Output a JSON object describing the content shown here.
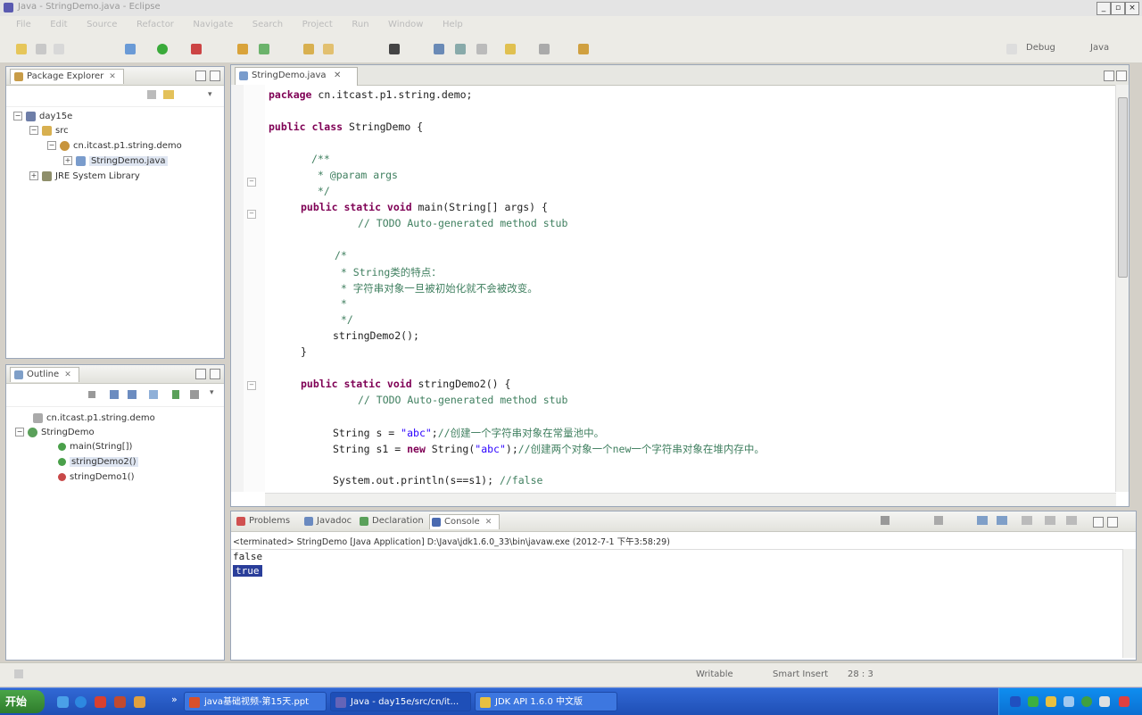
{
  "colors": {
    "keyword": "#7f0055",
    "string": "#2a00ff",
    "comment": "#3f7f5f",
    "taskbar": "#245edb",
    "start_button": "#3c8d39"
  },
  "menu": [
    "File",
    "Edit",
    "Source",
    "Refactor",
    "Navigate",
    "Search",
    "Project",
    "Run",
    "Window",
    "Help"
  ],
  "perspectives": {
    "debug": "Debug",
    "java": "Java"
  },
  "package_explorer": {
    "title": "Package Explorer",
    "project": "day15e",
    "src": "src",
    "package": "cn.itcast.p1.string.demo",
    "file": "StringDemo.java",
    "library": "JRE System Library"
  },
  "outline": {
    "title": "Outline",
    "package": "cn.itcast.p1.string.demo",
    "class": "StringDemo",
    "members": [
      "main(String[])",
      "stringDemo2()",
      "stringDemo1()"
    ]
  },
  "editor": {
    "tab_label": "StringDemo.java",
    "code": {
      "l1_kw": "package",
      "l1_rest": " cn.itcast.p1.string.demo;",
      "l2_kw": "public class",
      "l2_rest": " StringDemo {",
      "l3": "/**",
      "l4": " * @param args",
      "l5": " */",
      "l6_kw": "public static void",
      "l6_rest": " main(String[] args) {",
      "l7": "// TODO Auto-generated method stub",
      "l8": "/*",
      "l9": " * String类的特点：",
      "l10": " * 字符串对象一旦被初始化就不会被改变。",
      "l11": " *",
      "l12": " */",
      "l13": "stringDemo2();",
      "l14": "}",
      "l15_kw": "public static void",
      "l15_rest": " stringDemo2() {",
      "l16": "// TODO Auto-generated method stub",
      "l17_a": "String s = ",
      "l17_str": "\"abc\"",
      "l17_b": ";",
      "l17_cmt": "//创建一个字符串对象在常量池中。",
      "l18_a": "String s1 = ",
      "l18_kw": "new",
      "l18_b": " String(",
      "l18_str": "\"abc\"",
      "l18_c": ");",
      "l18_cmt": "//创建两个对象一个new一个字符串对象在堆内存中。",
      "l19": "System.out.println(s==s1);",
      "l19_cmt": "//false"
    }
  },
  "console": {
    "tabs": [
      "Problems",
      "Javadoc",
      "Declaration",
      "Console"
    ],
    "status": "<terminated> StringDemo [Java Application] D:\\Java\\jdk1.6.0_33\\bin\\javaw.exe (2012-7-1 下午3:58:29)",
    "output_1": "false",
    "output_2": "true"
  },
  "statusbar": {
    "writable": "Writable",
    "insert": "Smart Insert",
    "position": "28 : 3"
  },
  "taskbar": {
    "start": "开始",
    "tasks": [
      "java基础视频-第15天.ppt",
      "Java - day15e/src/cn/it...",
      "JDK API 1.6.0 中文版"
    ]
  }
}
